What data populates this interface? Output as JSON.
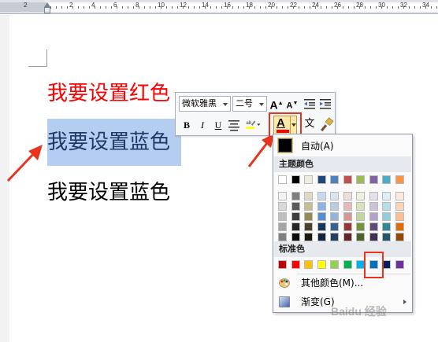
{
  "ruler": {
    "numbers": [
      "2",
      "2",
      "4",
      "6",
      "8",
      "10",
      "12",
      "14",
      "16",
      "18",
      "20",
      "22",
      "24",
      "26",
      "28",
      "30",
      "32",
      "34"
    ]
  },
  "document": {
    "lines": [
      {
        "text": "我要设置红色",
        "color": "#ff0000"
      },
      {
        "text": "我要设置蓝色",
        "color": "#1f3864",
        "selected": true,
        "highlight": "#b4cdf0"
      },
      {
        "text": "我要设置蓝色",
        "color": "#000000"
      }
    ]
  },
  "mini_toolbar": {
    "font_name": "微软雅黑",
    "font_size": "二号",
    "bold": "B",
    "italic": "I",
    "underline": "U",
    "font_color_letter": "A",
    "font_color_bar": "#ff0000",
    "grow_label": "A",
    "shrink_label": "A",
    "format_label": "文"
  },
  "color_menu": {
    "automatic_label": "自动(A)",
    "theme_colors_label": "主题颜色",
    "standard_colors_label": "标准色",
    "more_colors_label": "其他颜色(M)...",
    "gradient_label": "渐变(G)",
    "theme_columns": [
      [
        "#ffffff",
        "#f2f2f2",
        "#d8d8d8",
        "#bfbfbf",
        "#a5a5a5",
        "#7f7f7f"
      ],
      [
        "#000000",
        "#7f7f7f",
        "#595959",
        "#3f3f3f",
        "#262626",
        "#0c0c0c"
      ],
      [
        "#eeece1",
        "#ddd9c3",
        "#c4bd97",
        "#938953",
        "#494429",
        "#1d1b10"
      ],
      [
        "#1f497d",
        "#c6d9f0",
        "#8db3e2",
        "#548dd4",
        "#17365d",
        "#0f243e"
      ],
      [
        "#4f81bd",
        "#dbe5f1",
        "#b8cce4",
        "#95b3d7",
        "#366092",
        "#244061"
      ],
      [
        "#c0504d",
        "#f2dcdb",
        "#e5b9b7",
        "#d99694",
        "#953734",
        "#632423"
      ],
      [
        "#9bbb59",
        "#ebf1dd",
        "#d7e3bc",
        "#c3d69b",
        "#76923c",
        "#4f6128"
      ],
      [
        "#8064a2",
        "#e5e0ec",
        "#ccc1d9",
        "#b2a2c7",
        "#5f497a",
        "#3f3151"
      ],
      [
        "#4bacc6",
        "#dbeef3",
        "#b7dde8",
        "#92cddc",
        "#31859b",
        "#205867"
      ],
      [
        "#f79646",
        "#fdeada",
        "#fbd5b5",
        "#fac08f",
        "#e36c09",
        "#974806"
      ]
    ],
    "standard_colors": [
      "#c00000",
      "#ff0000",
      "#ffc000",
      "#ffff00",
      "#92d050",
      "#00b050",
      "#00b0f0",
      "#0070c0",
      "#002060",
      "#7030a0"
    ]
  },
  "watermark": "Baidu 经验"
}
